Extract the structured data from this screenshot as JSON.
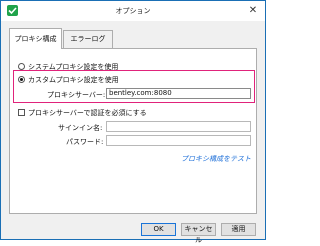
{
  "window": {
    "title": "オプション",
    "close_glyph": "✕"
  },
  "tabs": [
    {
      "label": "プロキシ構成",
      "active": true
    },
    {
      "label": "エラーログ",
      "active": false
    }
  ],
  "proxy": {
    "option_system": "システムプロキシ設定を使用",
    "option_custom": "カスタムプロキシ設定を使用",
    "selected": "custom",
    "server_label": "プロキシサーバー:",
    "server_value": "bentley.com:8080",
    "auth_checkbox_label": "プロキシサーバーで認証を必須にする",
    "auth_checked": false,
    "signin_label": "サインイン名:",
    "signin_value": "",
    "password_label": "パスワード:",
    "password_value": "",
    "test_link": "プロキシ構成をテスト"
  },
  "buttons": {
    "ok": "OK",
    "cancel": "キャンセル",
    "apply": "適用"
  },
  "colors": {
    "highlight": "#e0237b",
    "link": "#1c6ed8",
    "accent": "#1a74d8"
  }
}
